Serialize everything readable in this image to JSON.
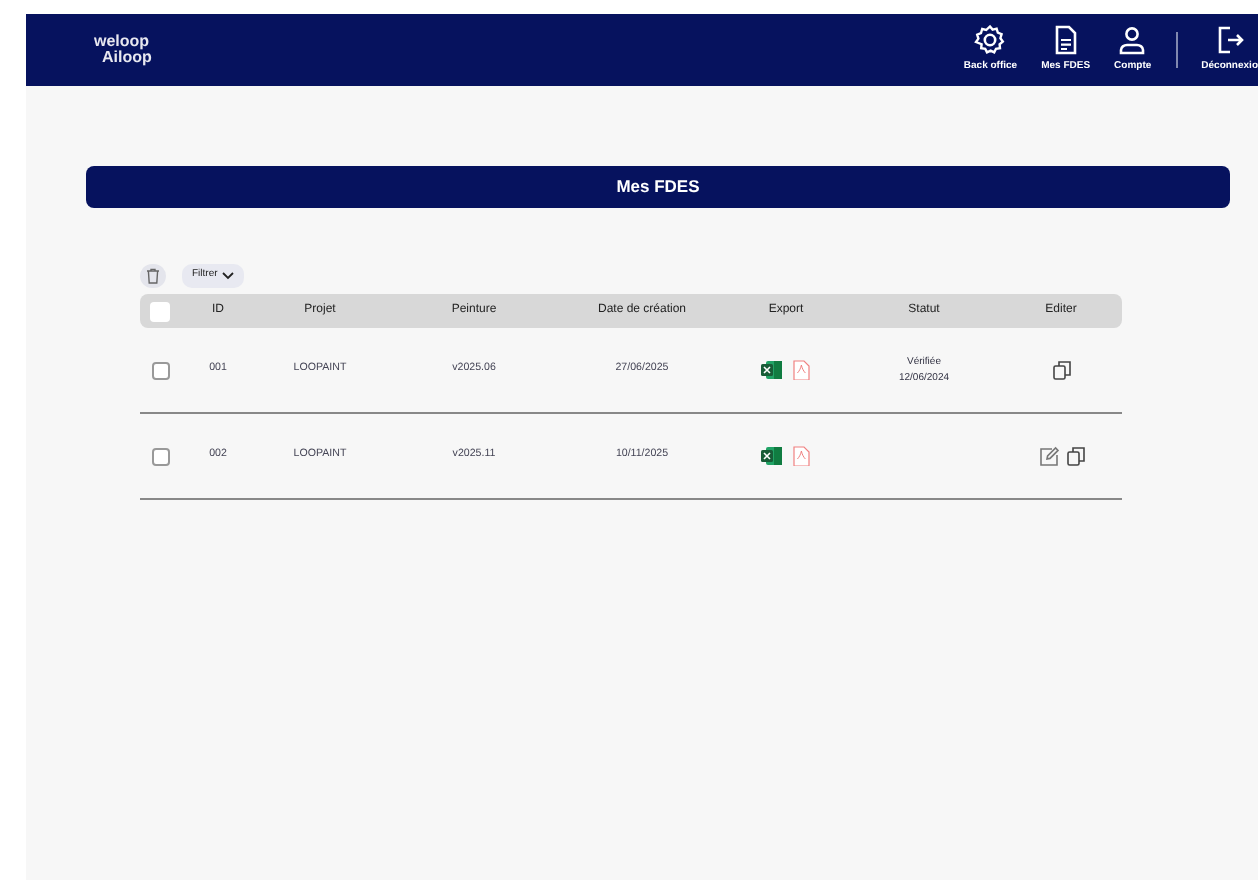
{
  "navbar": {
    "logo": {
      "line_1": "weloop",
      "line_2": "Ailoop"
    },
    "items": [
      {
        "kind": "gear",
        "label": "Back office"
      },
      {
        "kind": "document",
        "label": "Mes FDES"
      },
      {
        "kind": "user",
        "label": "Compte"
      },
      {
        "kind": "logout",
        "label": "Déconnexio"
      }
    ]
  },
  "page_title": "Mes FDES",
  "toolbar": {
    "filter": "Filtrer"
  },
  "table": {
    "select_all": {
      "checked": false
    },
    "columns": [
      "ID",
      "Projet",
      "Peinture",
      "Date de création",
      "Export",
      "Statut",
      "Editer"
    ],
    "rows": [
      {
        "checked": false,
        "id": "001",
        "project": "LOOPAINT",
        "paint": "v2025.06",
        "created": "27/06/2025",
        "status": [
          "Vérifiée",
          "12/06/2024"
        ],
        "editable": false
      },
      {
        "checked": false,
        "id": "002",
        "project": "LOOPAINT",
        "paint": "v2025.11",
        "created": "10/11/2025",
        "status": [],
        "editable": true
      }
    ]
  }
}
